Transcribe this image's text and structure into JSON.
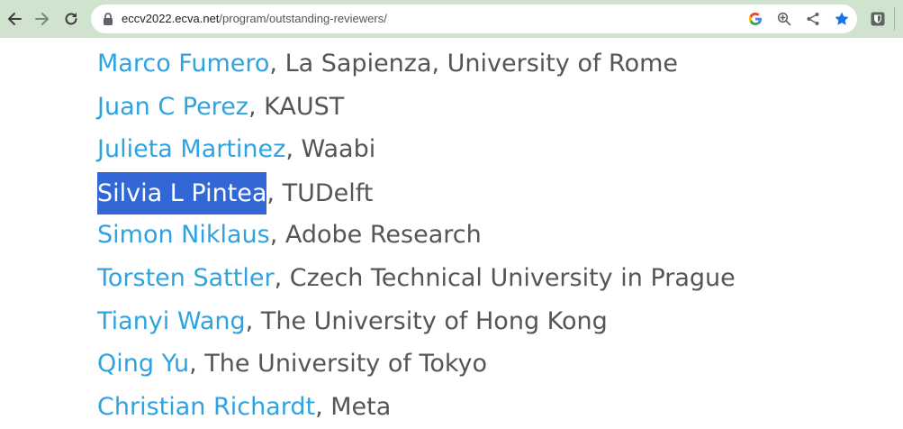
{
  "browser": {
    "url_host": "eccv2022.ecva.net",
    "url_path": "/program/outstanding-reviewers/",
    "icons": [
      "back-arrow-icon",
      "forward-arrow-icon",
      "reload-icon",
      "lock-icon",
      "google-icon",
      "zoom-icon",
      "share-icon",
      "bookmark-star-icon",
      "extension-shield-icon"
    ]
  },
  "reviewers": [
    {
      "name": "Marco Fumero",
      "affiliation": ", La Sapienza, University of Rome"
    },
    {
      "name": "Juan C Perez",
      "affiliation": ", KAUST"
    },
    {
      "name": "Julieta Martinez",
      "affiliation": ", Waabi"
    },
    {
      "name": "Silvia L Pintea",
      "affiliation": ", TUDelft",
      "selected": true
    },
    {
      "name": "Simon Niklaus",
      "affiliation": ", Adobe Research"
    },
    {
      "name": "Torsten Sattler",
      "affiliation": ", Czech Technical University in Prague"
    },
    {
      "name": "Tianyi Wang",
      "affiliation": ", The University of Hong Kong"
    },
    {
      "name": "Qing Yu",
      "affiliation": ", The University of Tokyo"
    },
    {
      "name": "Christian Richardt",
      "affiliation": ", Meta"
    }
  ],
  "colors": {
    "link": "#2ea3e0",
    "text": "#555555",
    "selection": "#3367d6",
    "toolbar": "#cfe3cf"
  }
}
